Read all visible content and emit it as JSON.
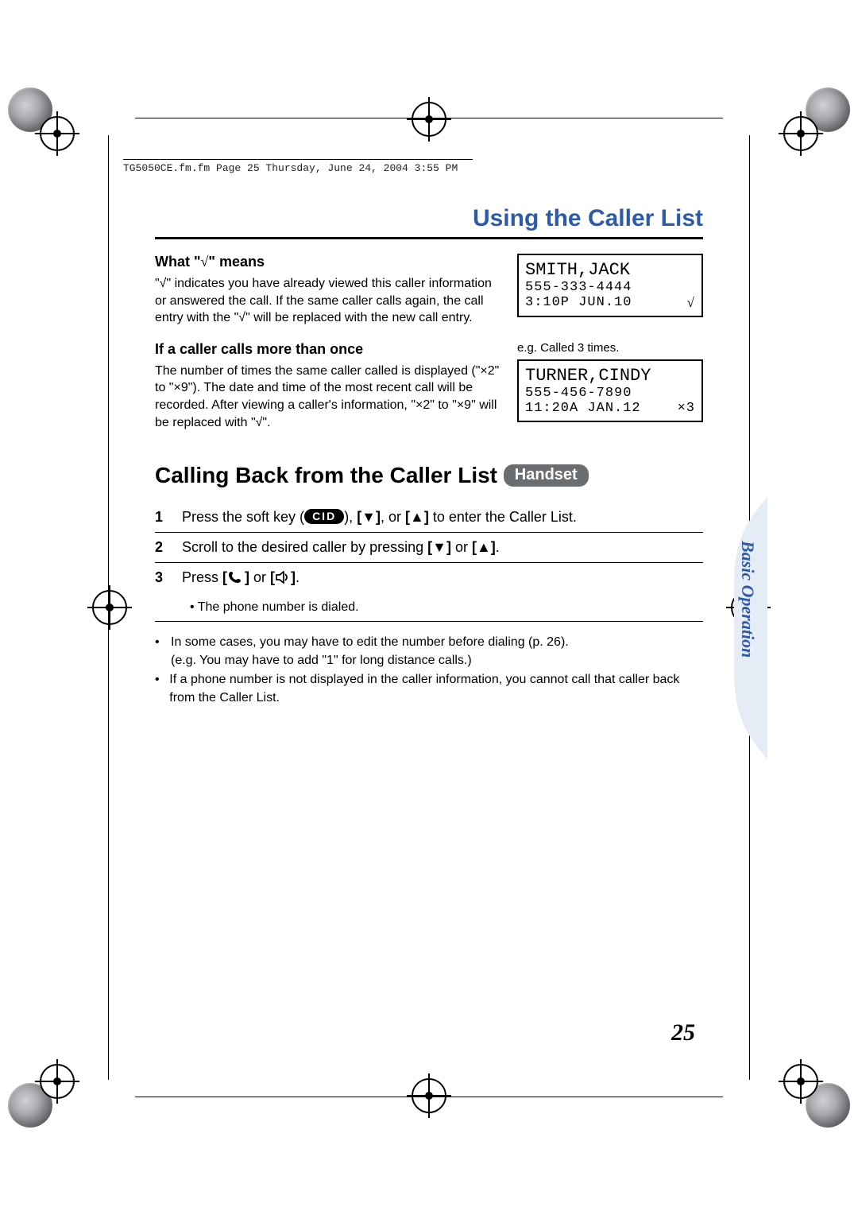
{
  "header_meta": "TG5050CE.fm.fm  Page 25  Thursday, June 24, 2004  3:55 PM",
  "title": "Using the Caller List",
  "side_tab_label": "Basic Operation",
  "page_number": "25",
  "section_check": {
    "heading_pre": "What \"",
    "heading_sym": "√",
    "heading_post": "\" means",
    "body": "\"√\" indicates you have already viewed this caller information or answered the call. If the same caller calls again, the call entry with the \"√\" will be replaced with the new call entry."
  },
  "lcd1": {
    "name": "SMITH,JACK",
    "number": "555-333-4444",
    "time": " 3:10P JUN.10",
    "mark": "√"
  },
  "section_multi": {
    "heading": "If a caller calls more than once",
    "body": "The number of times the same caller called is displayed (\"×2\" to \"×9\"). The date and time of the most recent call will be recorded. After viewing a caller's information, \"×2\" to \"×9\" will be replaced with \"√\"."
  },
  "lcd2": {
    "eg": "e.g. Called 3 times.",
    "name": "TURNER,CINDY",
    "number": "555-456-7890",
    "time": "11:20A JAN.12",
    "mark": "×3"
  },
  "callback": {
    "heading": "Calling Back from the Caller List",
    "pill": "Handset",
    "steps": [
      {
        "n": "1",
        "pre": "Press the soft key (",
        "cid": "CID",
        "post1": "), ",
        "k1": "[▼]",
        "mid": ", or ",
        "k2": "[▲]",
        "post2": " to enter the Caller List."
      },
      {
        "n": "2",
        "pre": "Scroll to the desired caller by pressing ",
        "k1": "[▼]",
        "mid": " or ",
        "k2": "[▲]",
        "post2": "."
      },
      {
        "n": "3",
        "pre": "Press ",
        "k1": "[",
        "k1b": "]",
        "mid": " or ",
        "k2": "[",
        "k2b": "]",
        "post2": ".",
        "sub": "• The phone number is dialed."
      }
    ],
    "notes": [
      {
        "line1": "In some cases, you may have to edit the number before dialing (p. 26).",
        "line2": "(e.g. You may have to add \"1\" for long distance calls.)"
      },
      {
        "line1": "If a phone number is not displayed in the caller information, you cannot call that caller back from the Caller List."
      }
    ]
  }
}
